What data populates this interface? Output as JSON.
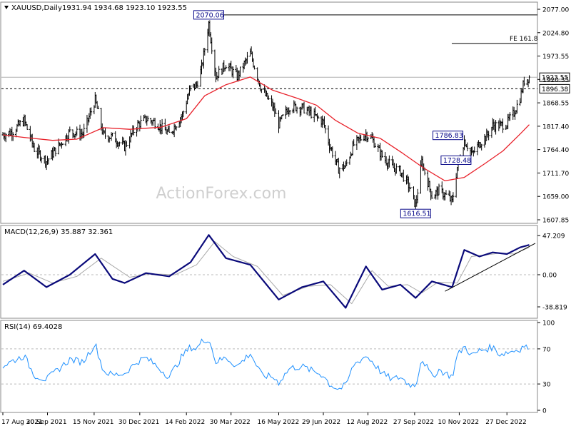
{
  "header": {
    "symbol": "XAUUSD,Daily",
    "ohlc": "1931.94 1934.68 1923.10 1923.55"
  },
  "watermark": "ActionForex.com",
  "colors": {
    "price_bars": "#000000",
    "sma": "#e8212a",
    "macd": "#0a0a7a",
    "signal": "#a9a9a9",
    "rsi": "#1e90ff",
    "label_box": "#0a0a8a",
    "grid": "#d0d0d0"
  },
  "chart_data": [
    {
      "type": "ohlc",
      "panel": "price",
      "ylim": [
        1585,
        2095
      ],
      "y_ticks": [
        "2077.00",
        "2024.80",
        "1973.55",
        "1920.35",
        "1868.55",
        "1817.40",
        "1764.40",
        "1711.70",
        "1659.00",
        "1607.85"
      ],
      "last_price_label": "1923.55",
      "annotations": [
        {
          "text": "2070.06",
          "date": "2022-03-08",
          "price": 2070.06
        },
        {
          "text": "1786.83",
          "date": "2022-11-15",
          "price": 1786.83
        },
        {
          "text": "1728.48",
          "date": "2022-11-23",
          "price": 1728.48
        },
        {
          "text": "1616.51",
          "date": "2022-09-28",
          "price": 1616.51
        }
      ],
      "levels": [
        {
          "label": "1896.38",
          "price": 1896.38,
          "style": "dashed"
        },
        {
          "label": "2070.06",
          "price": 2070.06,
          "style": "solid"
        },
        {
          "label": "FE 161.8",
          "price": 2003,
          "style": "solid"
        },
        {
          "label": "1923.55",
          "price": 1923.55,
          "style": "solid-grey"
        }
      ],
      "series": [
        {
          "role": "close",
          "points": [
            [
              "2021-08-17",
              1788
            ],
            [
              "2021-08-26",
              1795
            ],
            [
              "2021-09-07",
              1822
            ],
            [
              "2021-09-17",
              1755
            ],
            [
              "2021-09-29",
              1726
            ],
            [
              "2021-10-12",
              1765
            ],
            [
              "2021-10-22",
              1795
            ],
            [
              "2021-11-04",
              1790
            ],
            [
              "2021-11-16",
              1870
            ],
            [
              "2021-11-24",
              1788
            ],
            [
              "2021-12-03",
              1783
            ],
            [
              "2021-12-15",
              1760
            ],
            [
              "2021-12-27",
              1810
            ],
            [
              "2022-01-05",
              1825
            ],
            [
              "2022-01-14",
              1818
            ],
            [
              "2022-01-28",
              1790
            ],
            [
              "2022-02-10",
              1835
            ],
            [
              "2022-02-18",
              1898
            ],
            [
              "2022-02-24",
              1905
            ],
            [
              "2022-03-01",
              1945
            ],
            [
              "2022-03-08",
              2050
            ],
            [
              "2022-03-15",
              1925
            ],
            [
              "2022-03-25",
              1955
            ],
            [
              "2022-04-05",
              1925
            ],
            [
              "2022-04-18",
              1980
            ],
            [
              "2022-04-29",
              1895
            ],
            [
              "2022-05-10",
              1855
            ],
            [
              "2022-05-16",
              1813
            ],
            [
              "2022-05-27",
              1855
            ],
            [
              "2022-06-08",
              1852
            ],
            [
              "2022-06-16",
              1840
            ],
            [
              "2022-06-29",
              1818
            ],
            [
              "2022-07-05",
              1765
            ],
            [
              "2022-07-14",
              1708
            ],
            [
              "2022-07-21",
              1715
            ],
            [
              "2022-07-29",
              1765
            ],
            [
              "2022-08-10",
              1790
            ],
            [
              "2022-08-16",
              1778
            ],
            [
              "2022-08-26",
              1738
            ],
            [
              "2022-09-05",
              1712
            ],
            [
              "2022-09-13",
              1702
            ],
            [
              "2022-09-21",
              1670
            ],
            [
              "2022-09-28",
              1622
            ],
            [
              "2022-10-04",
              1725
            ],
            [
              "2022-10-14",
              1645
            ],
            [
              "2022-10-21",
              1657
            ],
            [
              "2022-10-31",
              1640
            ],
            [
              "2022-11-03",
              1630
            ],
            [
              "2022-11-08",
              1712
            ],
            [
              "2022-11-15",
              1775
            ],
            [
              "2022-11-23",
              1742
            ],
            [
              "2022-11-30",
              1768
            ],
            [
              "2022-12-07",
              1785
            ],
            [
              "2022-12-13",
              1810
            ],
            [
              "2022-12-20",
              1810
            ],
            [
              "2022-12-27",
              1815
            ],
            [
              "2023-01-03",
              1840
            ],
            [
              "2023-01-09",
              1875
            ],
            [
              "2023-01-13",
              1915
            ],
            [
              "2023-01-18",
              1923.55
            ]
          ]
        },
        {
          "role": "sma",
          "points": [
            [
              "2021-08-17",
              1788
            ],
            [
              "2021-09-07",
              1782
            ],
            [
              "2021-10-05",
              1775
            ],
            [
              "2021-10-29",
              1778
            ],
            [
              "2021-11-24",
              1805
            ],
            [
              "2021-12-20",
              1801
            ],
            [
              "2022-01-20",
              1806
            ],
            [
              "2022-02-14",
              1826
            ],
            [
              "2022-03-04",
              1880
            ],
            [
              "2022-03-25",
              1906
            ],
            [
              "2022-04-18",
              1924
            ],
            [
              "2022-05-10",
              1893
            ],
            [
              "2022-06-02",
              1875
            ],
            [
              "2022-06-22",
              1858
            ],
            [
              "2022-07-11",
              1822
            ],
            [
              "2022-08-02",
              1792
            ],
            [
              "2022-08-24",
              1780
            ],
            [
              "2022-09-15",
              1745
            ],
            [
              "2022-10-06",
              1710
            ],
            [
              "2022-10-27",
              1680
            ],
            [
              "2022-11-15",
              1688
            ],
            [
              "2022-12-05",
              1720
            ],
            [
              "2022-12-23",
              1750
            ],
            [
              "2023-01-09",
              1790
            ],
            [
              "2023-01-18",
              1812
            ]
          ]
        }
      ]
    },
    {
      "type": "line",
      "panel": "macd",
      "title": "MACD(12,26,9) 35.887 32.361",
      "ylim": [
        -50,
        56
      ],
      "y_ticks": [
        "47.209",
        "0.00",
        "-38.819"
      ],
      "series": [
        {
          "role": "macd",
          "points": [
            [
              "2021-08-17",
              -12
            ],
            [
              "2021-09-07",
              5
            ],
            [
              "2021-09-29",
              -15
            ],
            [
              "2021-10-22",
              0
            ],
            [
              "2021-11-16",
              25
            ],
            [
              "2021-12-03",
              -5
            ],
            [
              "2021-12-15",
              -10
            ],
            [
              "2022-01-05",
              2
            ],
            [
              "2022-01-28",
              -2
            ],
            [
              "2022-02-18",
              15
            ],
            [
              "2022-03-08",
              48
            ],
            [
              "2022-03-25",
              20
            ],
            [
              "2022-04-18",
              12
            ],
            [
              "2022-05-16",
              -30
            ],
            [
              "2022-06-08",
              -15
            ],
            [
              "2022-06-29",
              -8
            ],
            [
              "2022-07-21",
              -40
            ],
            [
              "2022-08-10",
              10
            ],
            [
              "2022-08-26",
              -18
            ],
            [
              "2022-09-13",
              -12
            ],
            [
              "2022-09-28",
              -28
            ],
            [
              "2022-10-14",
              -8
            ],
            [
              "2022-11-03",
              -15
            ],
            [
              "2022-11-15",
              30
            ],
            [
              "2022-11-30",
              22
            ],
            [
              "2022-12-13",
              27
            ],
            [
              "2022-12-27",
              25
            ],
            [
              "2023-01-09",
              33
            ],
            [
              "2023-01-18",
              36
            ]
          ]
        },
        {
          "role": "signal",
          "points": [
            [
              "2021-08-17",
              -8
            ],
            [
              "2021-09-12",
              2
            ],
            [
              "2021-10-05",
              -10
            ],
            [
              "2021-10-29",
              -2
            ],
            [
              "2021-11-22",
              20
            ],
            [
              "2021-12-20",
              -3
            ],
            [
              "2022-01-10",
              1
            ],
            [
              "2022-02-03",
              0
            ],
            [
              "2022-02-24",
              12
            ],
            [
              "2022-03-14",
              40
            ],
            [
              "2022-04-01",
              22
            ],
            [
              "2022-04-25",
              10
            ],
            [
              "2022-05-20",
              -25
            ],
            [
              "2022-06-14",
              -14
            ],
            [
              "2022-07-06",
              -12
            ],
            [
              "2022-07-27",
              -35
            ],
            [
              "2022-08-16",
              5
            ],
            [
              "2022-09-01",
              -14
            ],
            [
              "2022-09-20",
              -12
            ],
            [
              "2022-10-04",
              -22
            ],
            [
              "2022-10-20",
              -9
            ],
            [
              "2022-11-08",
              -10
            ],
            [
              "2022-11-22",
              22
            ],
            [
              "2022-12-07",
              24
            ],
            [
              "2022-12-20",
              26
            ],
            [
              "2023-01-03",
              25
            ],
            [
              "2023-01-18",
              33
            ]
          ]
        }
      ]
    },
    {
      "type": "line",
      "panel": "rsi",
      "title": "RSI(14) 69.4028",
      "ylim": [
        0,
        100
      ],
      "y_ticks": [
        "100",
        "70",
        "30",
        "0"
      ],
      "series": [
        {
          "role": "rsi",
          "points": [
            [
              "2021-08-17",
              50
            ],
            [
              "2021-08-26",
              56
            ],
            [
              "2021-09-07",
              62
            ],
            [
              "2021-09-17",
              40
            ],
            [
              "2021-09-29",
              35
            ],
            [
              "2021-10-12",
              48
            ],
            [
              "2021-10-22",
              58
            ],
            [
              "2021-11-04",
              55
            ],
            [
              "2021-11-16",
              76
            ],
            [
              "2021-11-24",
              45
            ],
            [
              "2021-12-03",
              40
            ],
            [
              "2021-12-15",
              42
            ],
            [
              "2021-12-27",
              55
            ],
            [
              "2022-01-05",
              60
            ],
            [
              "2022-01-14",
              52
            ],
            [
              "2022-01-28",
              38
            ],
            [
              "2022-02-10",
              62
            ],
            [
              "2022-02-18",
              72
            ],
            [
              "2022-02-24",
              70
            ],
            [
              "2022-03-01",
              78
            ],
            [
              "2022-03-08",
              82
            ],
            [
              "2022-03-15",
              55
            ],
            [
              "2022-03-25",
              60
            ],
            [
              "2022-04-05",
              50
            ],
            [
              "2022-04-18",
              65
            ],
            [
              "2022-04-29",
              40
            ],
            [
              "2022-05-10",
              38
            ],
            [
              "2022-05-16",
              32
            ],
            [
              "2022-05-27",
              48
            ],
            [
              "2022-06-08",
              50
            ],
            [
              "2022-06-16",
              46
            ],
            [
              "2022-06-29",
              40
            ],
            [
              "2022-07-05",
              30
            ],
            [
              "2022-07-14",
              24
            ],
            [
              "2022-07-21",
              28
            ],
            [
              "2022-07-29",
              52
            ],
            [
              "2022-08-10",
              62
            ],
            [
              "2022-08-16",
              56
            ],
            [
              "2022-08-26",
              42
            ],
            [
              "2022-09-05",
              35
            ],
            [
              "2022-09-13",
              38
            ],
            [
              "2022-09-21",
              30
            ],
            [
              "2022-09-28",
              28
            ],
            [
              "2022-10-04",
              60
            ],
            [
              "2022-10-14",
              38
            ],
            [
              "2022-10-21",
              46
            ],
            [
              "2022-10-31",
              40
            ],
            [
              "2022-11-03",
              38
            ],
            [
              "2022-11-08",
              62
            ],
            [
              "2022-11-15",
              73
            ],
            [
              "2022-11-23",
              62
            ],
            [
              "2022-11-30",
              68
            ],
            [
              "2022-12-07",
              70
            ],
            [
              "2022-12-13",
              72
            ],
            [
              "2022-12-20",
              64
            ],
            [
              "2022-12-27",
              66
            ],
            [
              "2023-01-03",
              68
            ],
            [
              "2023-01-09",
              70
            ],
            [
              "2023-01-13",
              74
            ],
            [
              "2023-01-18",
              69.4
            ]
          ]
        }
      ]
    }
  ],
  "x_axis": {
    "ticks": [
      {
        "label": "17 Aug 2021",
        "date": "2021-08-17"
      },
      {
        "label": "30 Sep 2021",
        "date": "2021-09-30"
      },
      {
        "label": "15 Nov 2021",
        "date": "2021-11-15"
      },
      {
        "label": "30 Dec 2021",
        "date": "2021-12-30"
      },
      {
        "label": "14 Feb 2022",
        "date": "2022-02-14"
      },
      {
        "label": "30 Mar 2022",
        "date": "2022-03-30"
      },
      {
        "label": "16 May 2022",
        "date": "2022-05-16"
      },
      {
        "label": "29 Jun 2022",
        "date": "2022-06-29"
      },
      {
        "label": "12 Aug 2022",
        "date": "2022-08-12"
      },
      {
        "label": "27 Sep 2022",
        "date": "2022-09-27"
      },
      {
        "label": "10 Nov 2022",
        "date": "2022-11-10"
      },
      {
        "label": "27 Dec 2022",
        "date": "2022-12-27"
      }
    ],
    "range": [
      "2021-08-17",
      "2023-01-24"
    ]
  }
}
